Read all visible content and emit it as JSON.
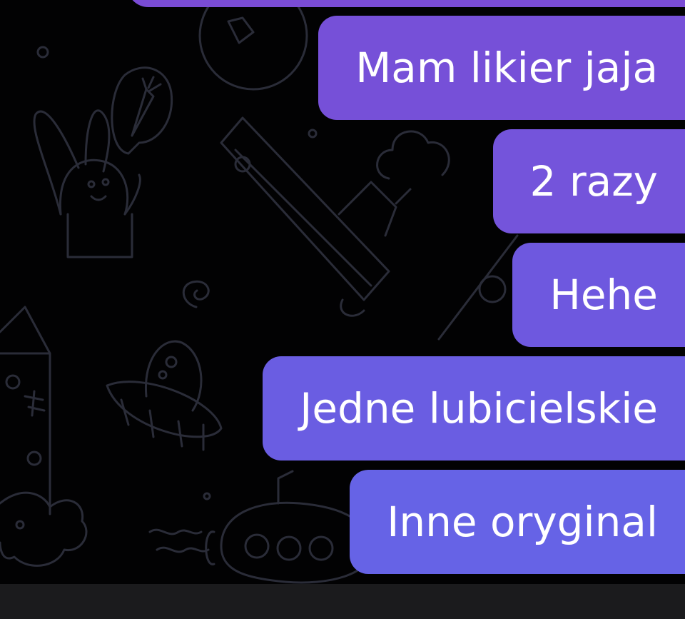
{
  "chat": {
    "messages": [
      {
        "text": "Mam likier jaja",
        "color": "#7650d8"
      },
      {
        "text": "2 razy",
        "color": "#7454db"
      },
      {
        "text": "Hehe",
        "color": "#6e58df"
      },
      {
        "text": "Jedne lubicielskie",
        "color": "#6a5de2"
      },
      {
        "text": "Inne oryginal",
        "color": "#6663e6"
      }
    ],
    "top_partial_color": "#7a4cd5"
  },
  "background": {
    "color": "#020203",
    "doodle_color": "#2a2c38"
  }
}
